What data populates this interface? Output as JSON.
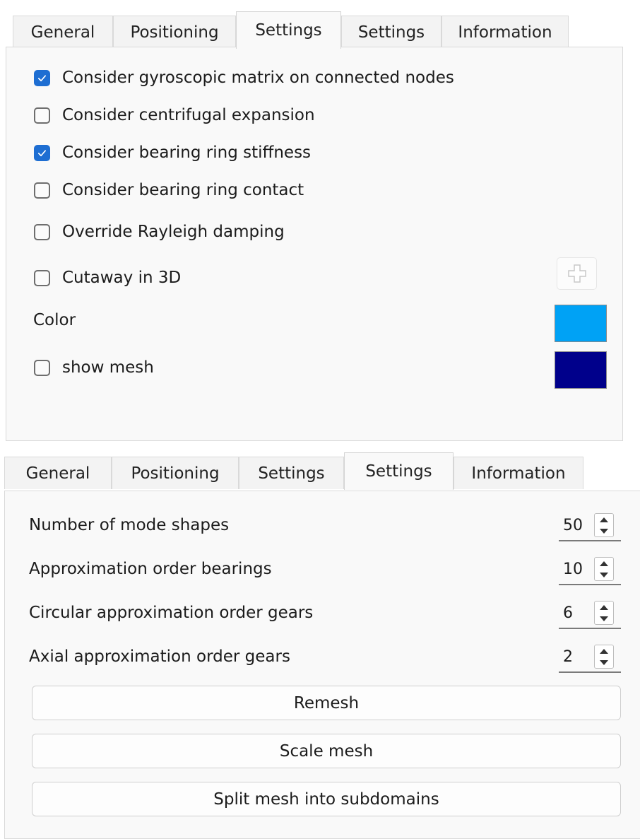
{
  "panel1": {
    "tabs": [
      {
        "label": "General",
        "active": false
      },
      {
        "label": "Positioning",
        "active": false
      },
      {
        "label": "Settings",
        "active": true
      },
      {
        "label": "Settings",
        "active": false
      },
      {
        "label": "Information",
        "active": false
      }
    ],
    "checkboxes": [
      {
        "label": "Consider gyroscopic matrix on connected nodes",
        "checked": true
      },
      {
        "label": "Consider centrifugal expansion",
        "checked": false
      },
      {
        "label": "Consider bearing ring stiffness",
        "checked": true
      },
      {
        "label": "Consider bearing ring contact",
        "checked": false
      },
      {
        "label": "Override Rayleigh damping",
        "checked": false
      },
      {
        "label": "Cutaway in 3D",
        "checked": false
      }
    ],
    "plus_button_icon": "plus-icon",
    "color_label": "Color",
    "color_value": "#00a2f5",
    "show_mesh_label": "show mesh",
    "show_mesh_checked": false,
    "mesh_color_value": "#00008b"
  },
  "panel2": {
    "tabs": [
      {
        "label": "General",
        "active": false
      },
      {
        "label": "Positioning",
        "active": false
      },
      {
        "label": "Settings",
        "active": false
      },
      {
        "label": "Settings",
        "active": true
      },
      {
        "label": "Information",
        "active": false
      }
    ],
    "spinners": [
      {
        "label": "Number of mode shapes",
        "value": "50"
      },
      {
        "label": "Approximation order bearings",
        "value": "10"
      },
      {
        "label": "Circular approximation order gears",
        "value": "6"
      },
      {
        "label": "Axial approximation order gears",
        "value": "2"
      }
    ],
    "buttons": [
      {
        "label": "Remesh"
      },
      {
        "label": "Scale mesh"
      },
      {
        "label": "Split mesh into subdomains"
      }
    ]
  },
  "colors": {
    "checkbox_accent": "#1e6ed2",
    "tab_background": "#f3f3f3",
    "panel_background": "#f9f9f9"
  }
}
